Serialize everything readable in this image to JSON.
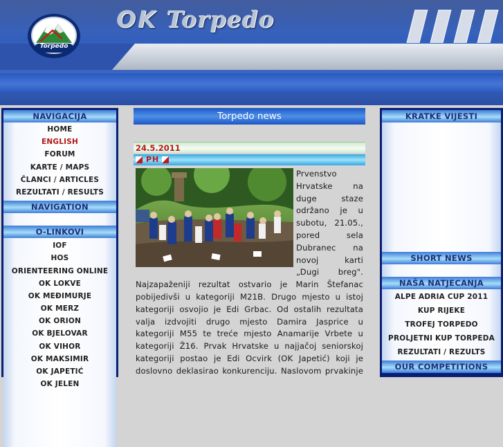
{
  "header": {
    "title_ok": "OK",
    "title_name": "Torpedo",
    "logo_text": "Torpedo"
  },
  "colors": {
    "header_blue": "#2f5bb8",
    "sidebar_border": "#0a1f73",
    "active_link": "#b01616",
    "date_red": "#b81a1a"
  },
  "left_sidebar": {
    "nav_heading": "NAVIGACIJA",
    "nav_items": [
      {
        "label": "HOME",
        "active": false
      },
      {
        "label": "ENGLISH",
        "active": true
      },
      {
        "label": "FORUM",
        "active": false
      },
      {
        "label": "KARTE / MAPS",
        "active": false
      },
      {
        "label": "ČLANCI / ARTICLES",
        "active": false
      },
      {
        "label": "REZULTATI / RESULTS",
        "active": false
      }
    ],
    "navigation_heading": "NAVIGATION",
    "links_heading": "O-LINKOVI",
    "link_items": [
      "IOF",
      "HOS",
      "ORIENTEERING ONLINE",
      "OK LOKVE",
      "OK MEĐIMURJE",
      "OK MERZ",
      "OK ORION",
      "OK BJELOVAR",
      "OK VIHOR",
      "OK MAKSIMIR",
      "OK JAPETIĆ",
      "OK JELEN"
    ]
  },
  "main": {
    "banner": "Torpedo news",
    "date": "24.5.2011",
    "tag": "PH",
    "article_text": "Prvenstvo Hrvatske na duge staze održano je u subotu, 21.05., pored sela Dubranec na novoj karti „Dugi breg\". Najzapaženiji rezultat ostvario je Marin Štefanac pobijedivši u kategoriji M21B. Drugo mjesto u istoj kategoriji osvojio je Edi Grbac. Od ostalih rezultata valja izdvojiti drugo mjesto Damira Jasprice u kategoriji M55 te treće mjesto Anamarije Vrbete u kategoriji Ž16. Prvak Hrvatske u najjačoj seniorskoj kategoriji postao je Edi Ocvirk (OK Japetić) koji je doslovno deklasirao konkurenciju. Naslovom prvakinje Hrvatske okrunila se je Sonja Lesjak iz OK Japetić."
  },
  "right_sidebar": {
    "news_heading": "KRATKE VIJESTI",
    "short_news_heading": "SHORT NEWS",
    "competitions_heading": "NAŠA NATJECANJA",
    "competition_items": [
      "ALPE ADRIA CUP 2011",
      "KUP RIJEKE",
      "TROFEJ TORPEDO",
      "PROLJETNI KUP TORPEDA",
      "REZULTATI / REZULTS"
    ],
    "our_competitions_heading": "OUR COMPETITIONS"
  }
}
